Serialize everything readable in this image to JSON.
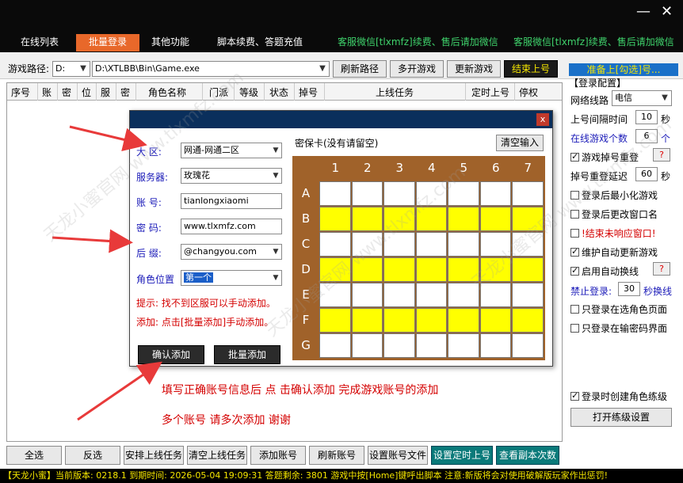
{
  "window": {
    "minimize": "—",
    "close": "✕"
  },
  "tabs": [
    {
      "label": "在线列表"
    },
    {
      "label": "批量登录"
    },
    {
      "label": "其他功能"
    },
    {
      "label": "脚本续费、答题充值"
    },
    {
      "label": "客服微信[tlxmfz]续费、售后请加微信"
    },
    {
      "label": "客服微信[tlxmfz]续费、售后请加微信"
    }
  ],
  "pathbar": {
    "label": "游戏路径:",
    "drive": "D:",
    "path": "D:\\XTLBB\\Bin\\Game.exe",
    "refresh_path": "刷新路径",
    "multi_open": "多开游戏",
    "update_game": "更新游戏",
    "end_online": "结束上号"
  },
  "table": {
    "headers": [
      "序号",
      "账",
      "密",
      "位",
      "服",
      "密",
      "角色名称",
      "门派",
      "等级",
      "状态",
      "掉号",
      "上线任务",
      "定时上号",
      "停权"
    ]
  },
  "right": {
    "ready": "准备上[勾选]号...",
    "config_title": "【登录配置】",
    "line_label": "网络线路",
    "line_value": "电信",
    "interval_label": "上号间隔时间",
    "interval_value": "10",
    "interval_unit": "秒",
    "online_count_label": "在线游戏个数",
    "online_count_value": "6",
    "online_count_unit": "个",
    "drop_relog": "游戏掉号重登",
    "drop_delay_label": "掉号重登延迟",
    "drop_delay_value": "60",
    "drop_delay_unit": "秒",
    "minimize_after": "登录后最小化游戏",
    "rename_window": "登录后更改窗口名",
    "end_unresponsive": "!结束未响应窗口!",
    "auto_update": "维护自动更新游戏",
    "auto_switch": "启用自动换线",
    "forbid_login": "禁止登录:",
    "forbid_value": "30",
    "forbid_unit": "秒换线",
    "only_role_page": "只登录在选角色页面",
    "only_pwd_page": "只登录在输密码界面",
    "create_char": "登录时创建角色练级",
    "open_level_settings": "打开练级设置",
    "help": "?"
  },
  "bottom": {
    "buttons": [
      "全选",
      "反选",
      "安排上线任务",
      "清空上线任务",
      "添加账号",
      "刷新账号",
      "设置账号文件",
      "设置定时上号",
      "查看副本次数"
    ]
  },
  "status": "【天龙小蜜】当前版本: 0218.1   到期时间: 2026-05-04 19:09:31   答题剩余: 3801   游戏中按[Home]键呼出脚本   注意:新版将会对使用破解版玩家作出惩罚!",
  "dialog": {
    "close": "x",
    "fields": [
      {
        "label": "大 区:",
        "value": "网通-网通二区",
        "dropdown": true
      },
      {
        "label": "服务器:",
        "value": "玫瑰花",
        "dropdown": true
      },
      {
        "label": "账 号:",
        "value": "tianlongxiaomi",
        "dropdown": false
      },
      {
        "label": "密 码:",
        "value": "www.tlxmfz.com",
        "dropdown": false
      },
      {
        "label": "后 缀:",
        "value": "@changyou.com",
        "dropdown": true
      },
      {
        "label": "角色位置",
        "value": "第一个",
        "dropdown": true
      }
    ],
    "hint1": "提示: 找不到区服可以手动添加。",
    "hint2": "添加: 点击[批量添加]手动添加。",
    "confirm_add": "确认添加",
    "batch_add": "批量添加",
    "card_title": "密保卡(没有请留空)",
    "clear_input": "清空输入",
    "cols": [
      "1",
      "2",
      "3",
      "4",
      "5",
      "6",
      "7"
    ],
    "rows": [
      "A",
      "B",
      "C",
      "D",
      "E",
      "F",
      "G"
    ],
    "highlight_rows": [
      "B",
      "D",
      "F"
    ],
    "highlight_color": "#ffff00"
  },
  "instructions": {
    "line1": "填写正确账号信息后 点 击确认添加 完成游戏账号的添加",
    "line2": "多个账号 请多次添加 谢谢"
  },
  "watermark": "天龙小蜜官网 www.tlxmfz.com",
  "colors": {
    "accent_tab": "#e8682a",
    "link_green": "#3fd36c",
    "instruction_red": "#d40000",
    "arrow_red": "#e83a3a"
  }
}
